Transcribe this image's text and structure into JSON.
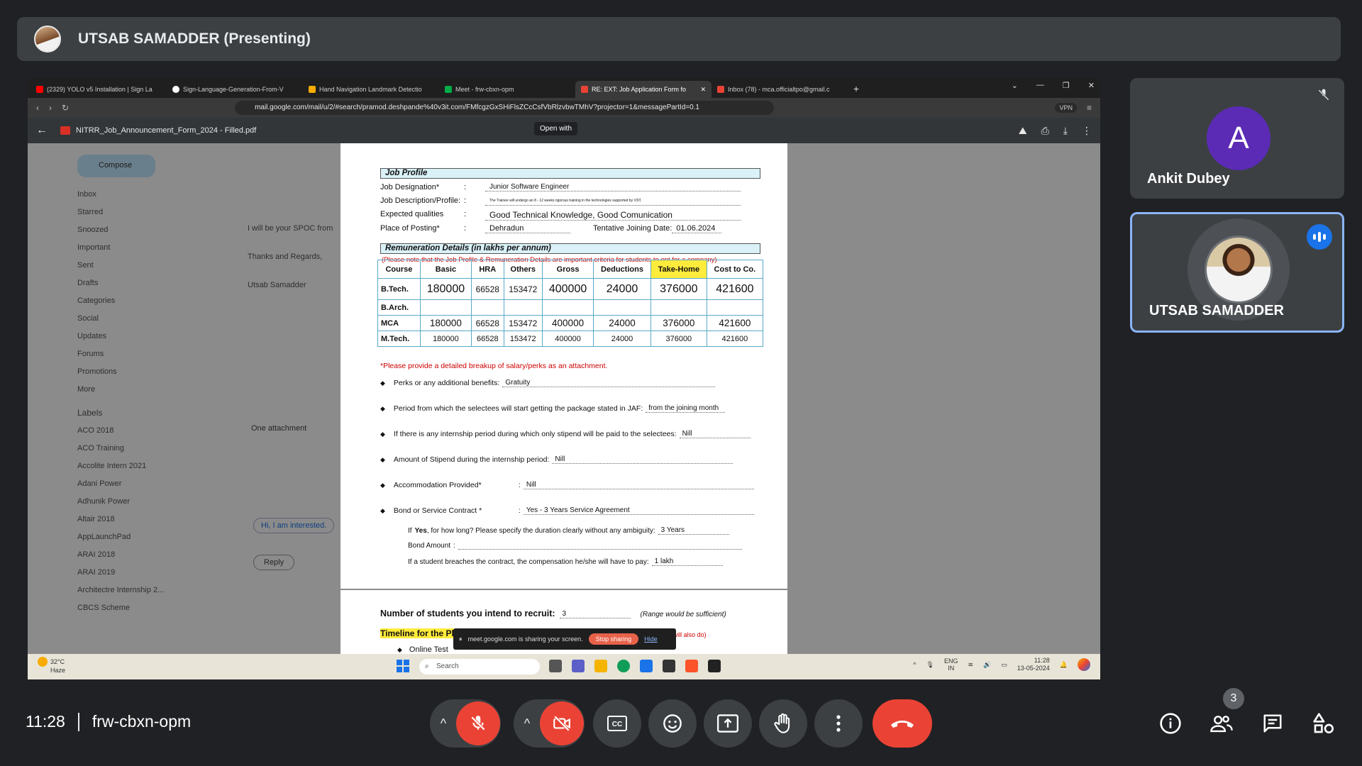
{
  "presenter": {
    "name": "UTSAB SAMADDER (Presenting)"
  },
  "browser": {
    "tabs": [
      {
        "title": "(2329) YOLO v5 Installation | Sign La",
        "color": "#ff0000"
      },
      {
        "title": "Sign-Language-Generation-From-V",
        "color": "#ffffff"
      },
      {
        "title": "Hand Navigation Landmark Detectio",
        "color": "#f9ab00"
      },
      {
        "title": "Meet - frw-cbxn-opm",
        "color": "#00ac47"
      },
      {
        "title": "RE: EXT: Job Application Form fo",
        "color": "#ea4335"
      },
      {
        "title": "Inbox (78) - mca.officialtpo@gmail.c",
        "color": "#ea4335"
      }
    ],
    "url": "mail.google.com/mail/u/2/#search/pramod.deshpande%40v3it.com/FMfcgzGxSHiFlsZCcCsfVbRlzvbwTMhV?projector=1&messagePartId=0.1",
    "vpn": "VPN"
  },
  "pdf": {
    "filename": "NITRR_Job_Announcement_Form_2024 - Filled.pdf",
    "open_with": "Open with"
  },
  "gmail": {
    "compose": "Compose",
    "folders": [
      "Inbox",
      "Starred",
      "Snoozed",
      "Important",
      "Sent",
      "Drafts",
      "Categories",
      "Social",
      "Updates",
      "Forums",
      "Promotions",
      "More"
    ],
    "labels_title": "Labels",
    "labels": [
      "ACO 2018",
      "ACO Training",
      "Accolite Intern 2021",
      "Adani Power",
      "Adhunik Power",
      "Altair 2018",
      "AppLaunchPad",
      "ARAI 2018",
      "ARAI 2019",
      "Architectre Internship 2...",
      "CBCS Scheme"
    ],
    "attachment_label": "One attachment",
    "reply": "Reply",
    "reply_snippet": "Hi, I am interested.",
    "body_line": "I will be your SPOC from",
    "thanks": "Thanks and Regards,",
    "sender": "Utsab Samadder"
  },
  "job_profile": {
    "header": "Job Profile",
    "fields": [
      {
        "label": "Job Designation*",
        "value": "Junior Software Engineer"
      },
      {
        "label": "Job Description/Profile:",
        "value": "The Trainee will undergo an 8 - 12 weeks rigorous training in the technologies supported by V3iT."
      },
      {
        "label": "Expected qualities",
        "value": "Good Technical Knowledge, Good Comunication"
      },
      {
        "label": "Place of Posting*",
        "value": "Dehradun"
      }
    ],
    "joining_label": "Tentative Joining Date:",
    "joining_value": "01.06.2024"
  },
  "remuneration": {
    "header": "Remuneration Details (in lakhs per annum)",
    "note": "(Please note that the Job Profile & Remuneration Details are important criteria for students to opt for a company)",
    "columns": [
      "Course",
      "Basic",
      "HRA",
      "Others",
      "Gross",
      "Deductions",
      "Take-Home",
      "Cost to Co."
    ],
    "rows": [
      {
        "course": "B.Tech.",
        "cells": [
          "180000",
          "66528",
          "153472",
          "400000",
          "24000",
          "376000",
          "421600"
        ]
      },
      {
        "course": "B.Arch.",
        "cells": [
          "",
          "",
          "",
          "",
          "",
          "",
          ""
        ]
      },
      {
        "course": "MCA",
        "cells": [
          "180000",
          "66528",
          "153472",
          "400000",
          "24000",
          "376000",
          "421600"
        ]
      },
      {
        "course": "M.Tech.",
        "cells": [
          "180000",
          "66528",
          "153472",
          "400000",
          "24000",
          "376000",
          "421600"
        ]
      }
    ],
    "footnote": "*Please provide a detailed breakup of salary/perks as an attachment."
  },
  "details": [
    {
      "label": "Perks or any additional benefits:",
      "value": "Gratuity"
    },
    {
      "label": "Period from which the selectees will start getting the package stated in JAF:",
      "value": "from the joining month"
    },
    {
      "label": "If there is any internship period during which only stipend will be paid to the selectees:",
      "value": "Nill"
    },
    {
      "label": "Amount of Stipend during the internship period:",
      "value": "Nill"
    },
    {
      "label": "Accommodation Provided*",
      "value": "Nill"
    },
    {
      "label": "Bond or Service Contract *",
      "value": "Yes - 3 Years Service Agreement"
    }
  ],
  "bond": {
    "q1_prefix": "If",
    "q1_yes": "Yes",
    "q1_rest": ", for how long? Please specify the duration clearly without any ambiguity:",
    "q1_value": "3 Years",
    "q2": "Bond Amount",
    "q3": "If a student breaches the contract, the compensation he/she will have to pay:",
    "q3_value": "1 lakh"
  },
  "page2": {
    "recruit_label": "Number of students you intend to recruit:",
    "recruit_value": "3",
    "recruit_note": "(Range would be sufficient)",
    "timeline": "Timeline for the Placement Process",
    "timeline_note": "(mandatory) (Details to start and finish the process will also do)",
    "online_test": "Online Test"
  },
  "share_notice": {
    "text": "meet.google.com is sharing your screen.",
    "stop": "Stop sharing",
    "hide": "Hide"
  },
  "taskbar": {
    "temp": "32°C",
    "weather": "Haze",
    "search": "Search",
    "lang1": "ENG",
    "lang2": "IN",
    "time": "11:28",
    "date": "13-05-2024"
  },
  "participants": [
    {
      "name": "Ankit Dubey",
      "initial": "A"
    },
    {
      "name": "UTSAB SAMADDER"
    }
  ],
  "meeting": {
    "time": "11:28",
    "code": "frw-cbxn-opm",
    "participant_count": "3"
  }
}
